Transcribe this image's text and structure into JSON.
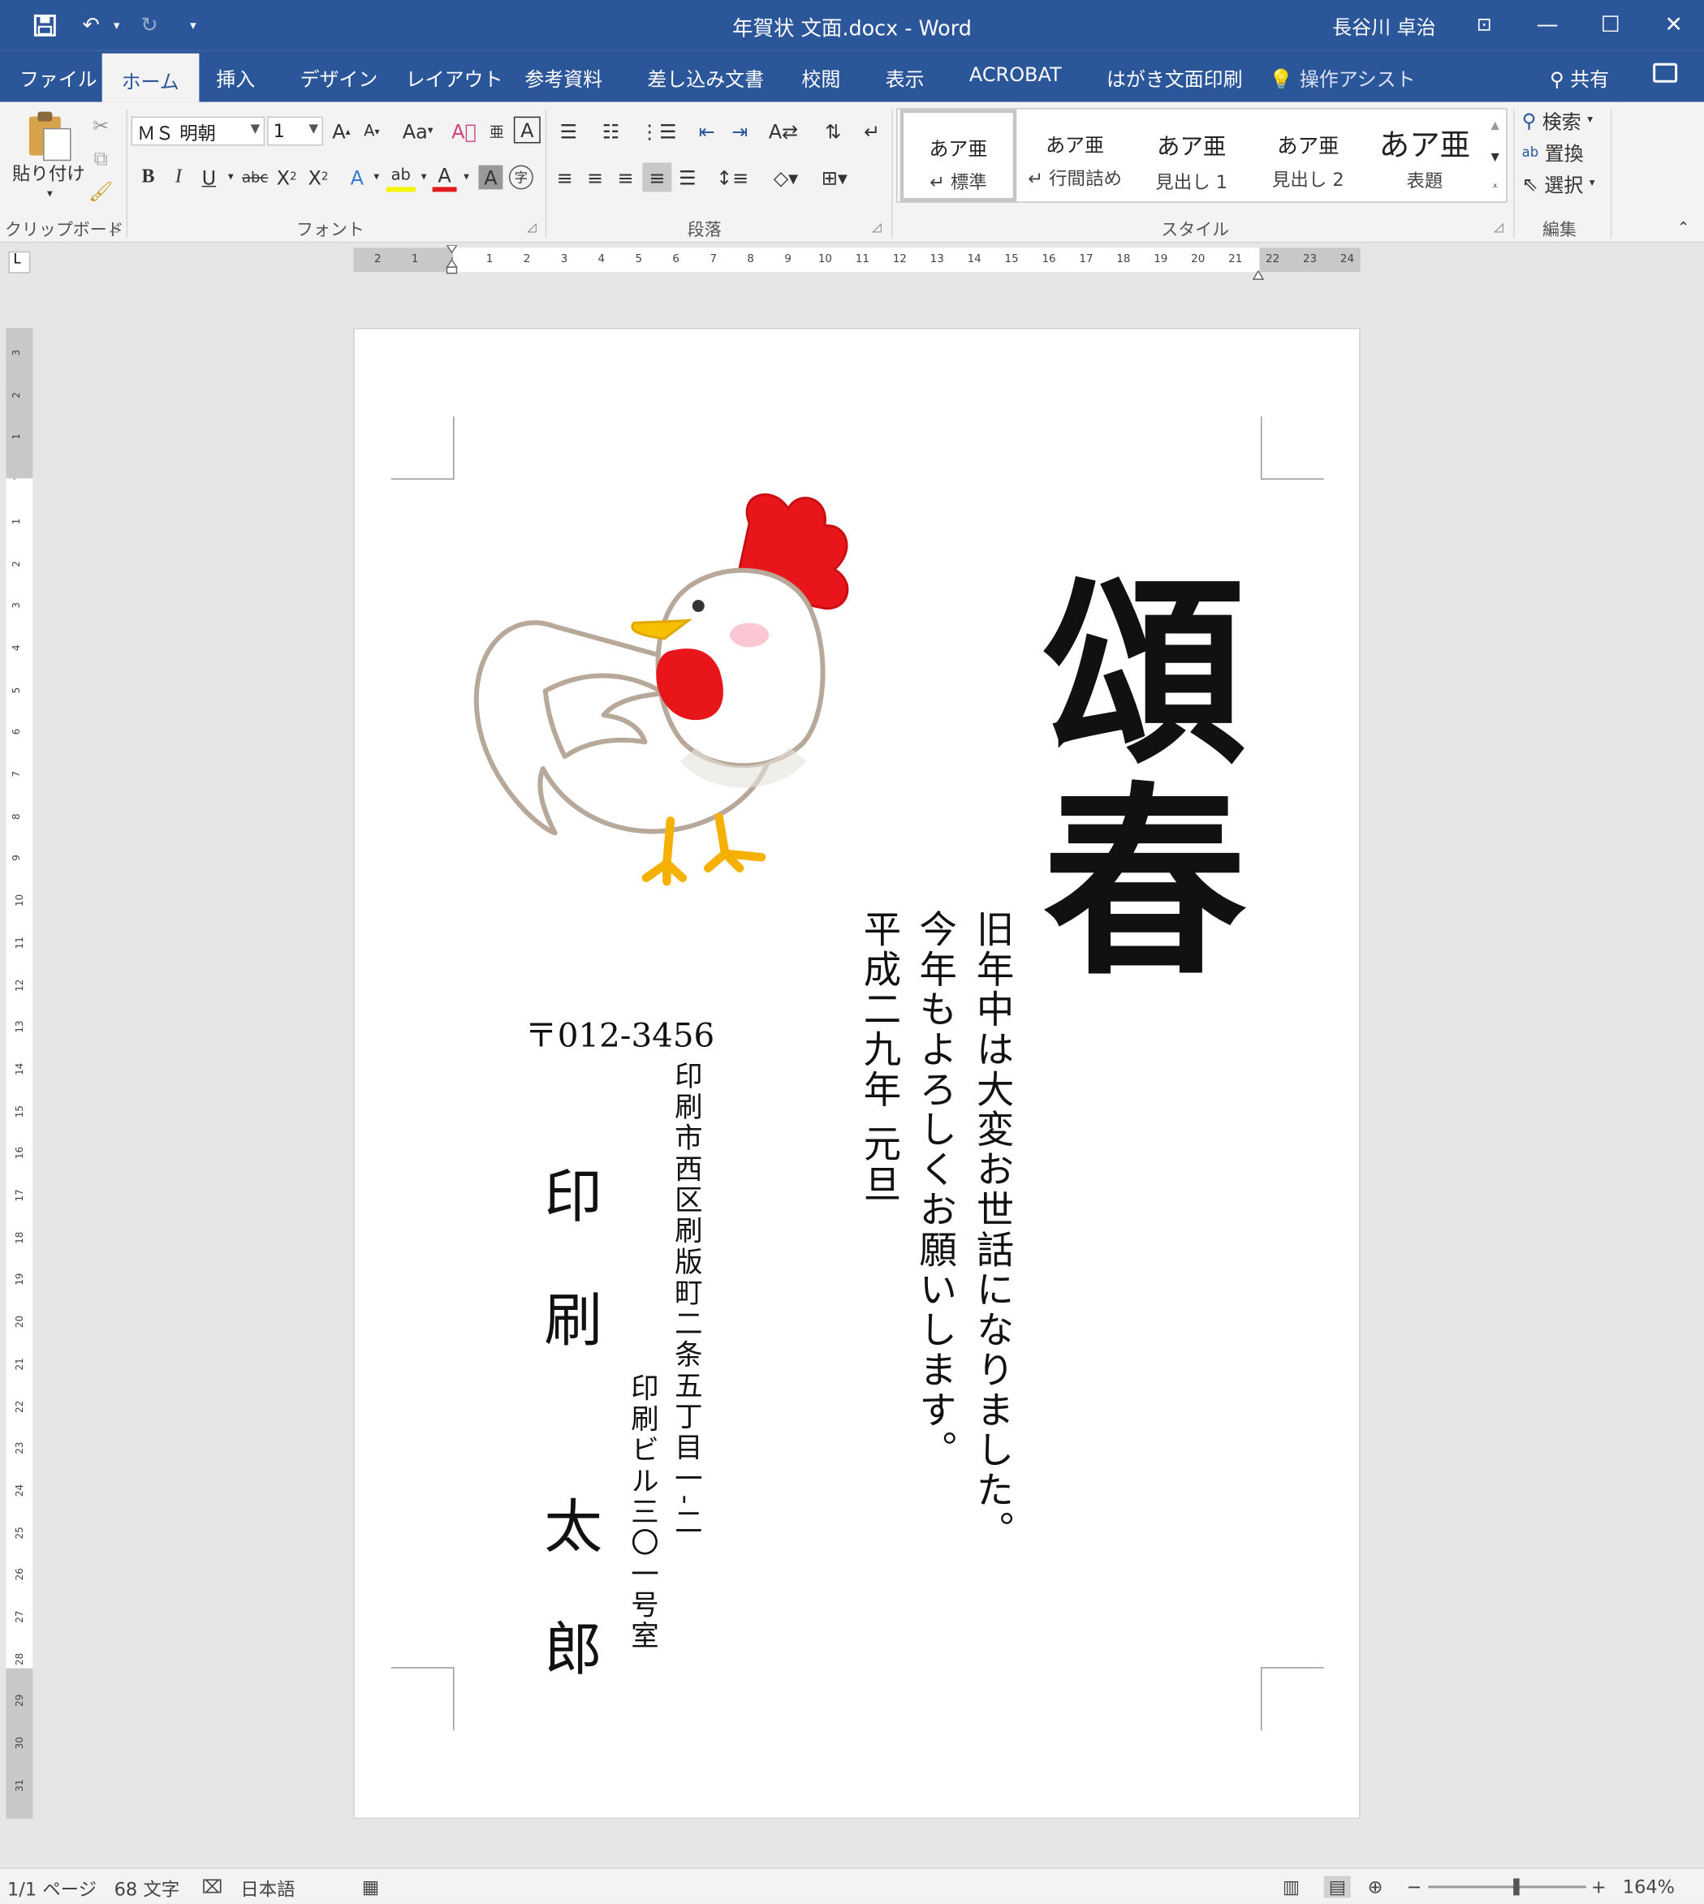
{
  "window": {
    "title": "年賀状 文面.docx - Word",
    "user": "長谷川 卓治"
  },
  "tabs": [
    "ファイル",
    "ホーム",
    "挿入",
    "デザイン",
    "レイアウト",
    "参考資料",
    "差し込み文書",
    "校閲",
    "表示",
    "ACROBAT",
    "はがき文面印刷"
  ],
  "active_tab": "ホーム",
  "assist": "操作アシスト",
  "share": "共有",
  "ribbon": {
    "clipboard": {
      "paste": "貼り付け",
      "label": "クリップボード"
    },
    "font": {
      "name": "ＭＳ 明朝",
      "size": "1",
      "label": "フォント",
      "case_btn": "Aa"
    },
    "paragraph": {
      "label": "段落"
    },
    "styles": {
      "label": "スタイル",
      "items": [
        {
          "preview": "あア亜",
          "name": "標準"
        },
        {
          "preview": "あア亜",
          "name": "行間詰め"
        },
        {
          "preview": "あア亜",
          "name": "見出し 1"
        },
        {
          "preview": "あア亜",
          "name": "見出し 2"
        },
        {
          "preview": "あア亜",
          "name": "表題"
        }
      ]
    },
    "editing": {
      "label": "編集",
      "find": "検索",
      "replace": "置換",
      "select": "選択"
    }
  },
  "ruler": {
    "h_ticks": [
      "2",
      "1",
      "",
      "1",
      "2",
      "3",
      "4",
      "5",
      "6",
      "7",
      "8",
      "9",
      "10",
      "11",
      "12",
      "13",
      "14",
      "15",
      "16",
      "17",
      "18",
      "19",
      "20",
      "21",
      "22",
      "23",
      "24"
    ],
    "v_ticks": [
      "3",
      "2",
      "1",
      "",
      "1",
      "2",
      "3",
      "4",
      "5",
      "6",
      "7",
      "8",
      "9",
      "10",
      "11",
      "12",
      "13",
      "14",
      "15",
      "16",
      "17",
      "18",
      "19",
      "20",
      "21",
      "22",
      "23",
      "24",
      "25",
      "26",
      "27",
      "28",
      "29",
      "30",
      "31"
    ]
  },
  "document": {
    "headline": "頌春",
    "greeting_lines": [
      "旧年中は大変お世話になりました。",
      "今年もよろしくお願いします。",
      "平成二九年 元旦"
    ],
    "postal_code": "〒012-3456",
    "address_line1": "印刷市西区刷版町二条五丁目一-二",
    "address_line2": "印刷ビル三〇一号室",
    "name_chars": [
      "印",
      "刷",
      "太",
      "郎"
    ]
  },
  "status": {
    "page": "1/1 ページ",
    "words": "68 文字",
    "language": "日本語",
    "zoom": "164%"
  },
  "colors": {
    "accent": "#2b579a",
    "rooster_comb": "#e8161b",
    "rooster_beak": "#f5c000"
  }
}
